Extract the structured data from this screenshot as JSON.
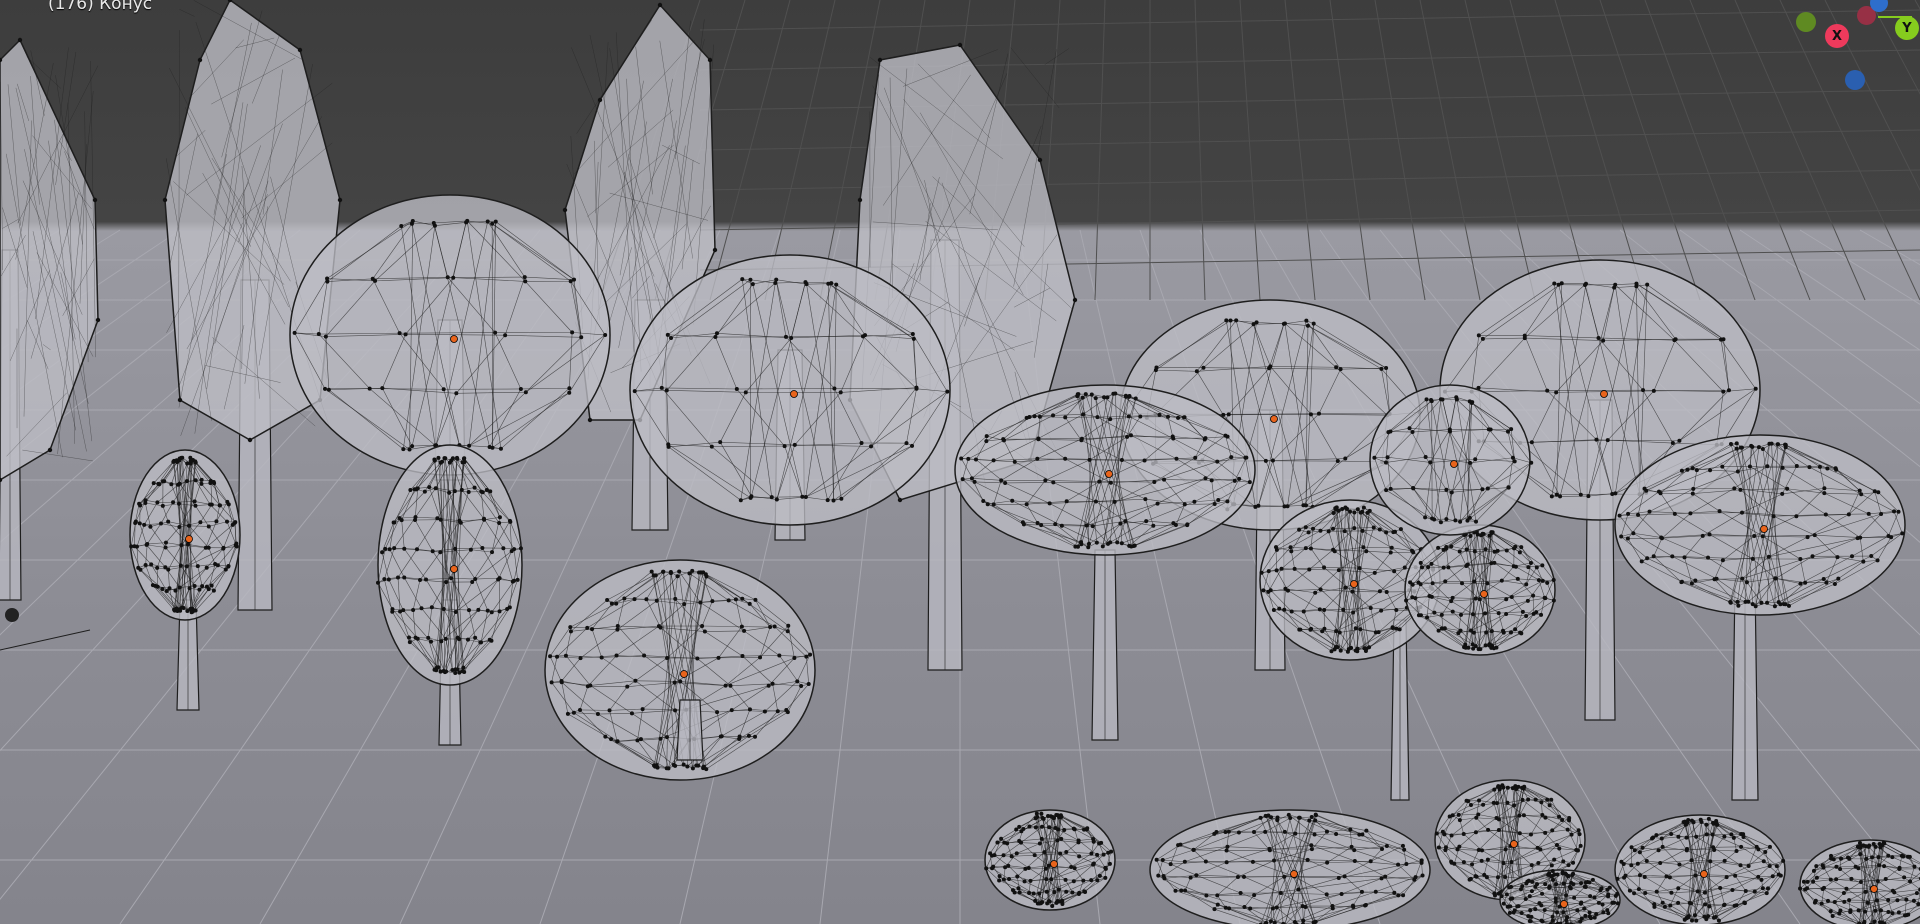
{
  "viewport": {
    "label": "(176) Конус"
  },
  "gizmo": {
    "x_label": "X",
    "y_label": "Y",
    "colors": {
      "x": "#ee3a5c",
      "y": "#86cc1e",
      "z": "#2e6ecc"
    }
  },
  "colors": {
    "background_top": "#3d3d3d",
    "floor": "#9a9aa2",
    "mesh_fill": "#bdbdc4",
    "wire": "#1e1e1e",
    "vertex": "#111111",
    "origin": "#e8641c"
  }
}
